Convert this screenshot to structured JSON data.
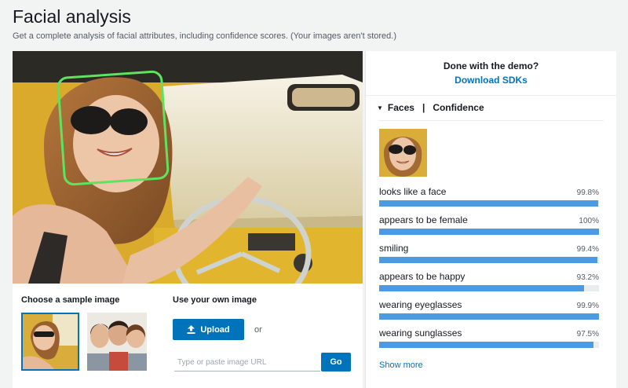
{
  "page": {
    "title": "Facial analysis",
    "subtitle": "Get a complete analysis of facial attributes, including confidence scores. (Your images aren't stored.)"
  },
  "samples": {
    "heading": "Choose a sample image"
  },
  "own_image": {
    "heading": "Use your own image",
    "upload_label": "Upload",
    "or_label": "or",
    "url_placeholder": "Type or paste image URL",
    "go_label": "Go"
  },
  "demo": {
    "question": "Done with the demo?",
    "link": "Download SDKs"
  },
  "results": {
    "faces_label": "Faces",
    "separator": "|",
    "confidence_label": "Confidence",
    "attributes": [
      {
        "label": "looks like a face",
        "value": "99.8%",
        "confidence": 99.8
      },
      {
        "label": "appears to be female",
        "value": "100%",
        "confidence": 100
      },
      {
        "label": "smiling",
        "value": "99.4%",
        "confidence": 99.4
      },
      {
        "label": "appears to be happy",
        "value": "93.2%",
        "confidence": 93.2
      },
      {
        "label": "wearing eyeglasses",
        "value": "99.9%",
        "confidence": 99.9
      },
      {
        "label": "wearing sunglasses",
        "value": "97.5%",
        "confidence": 97.5
      }
    ],
    "show_more": "Show more"
  },
  "colors": {
    "accent": "#0073bb",
    "bar": "#4a9be3",
    "face_box": "#5ee35e"
  }
}
